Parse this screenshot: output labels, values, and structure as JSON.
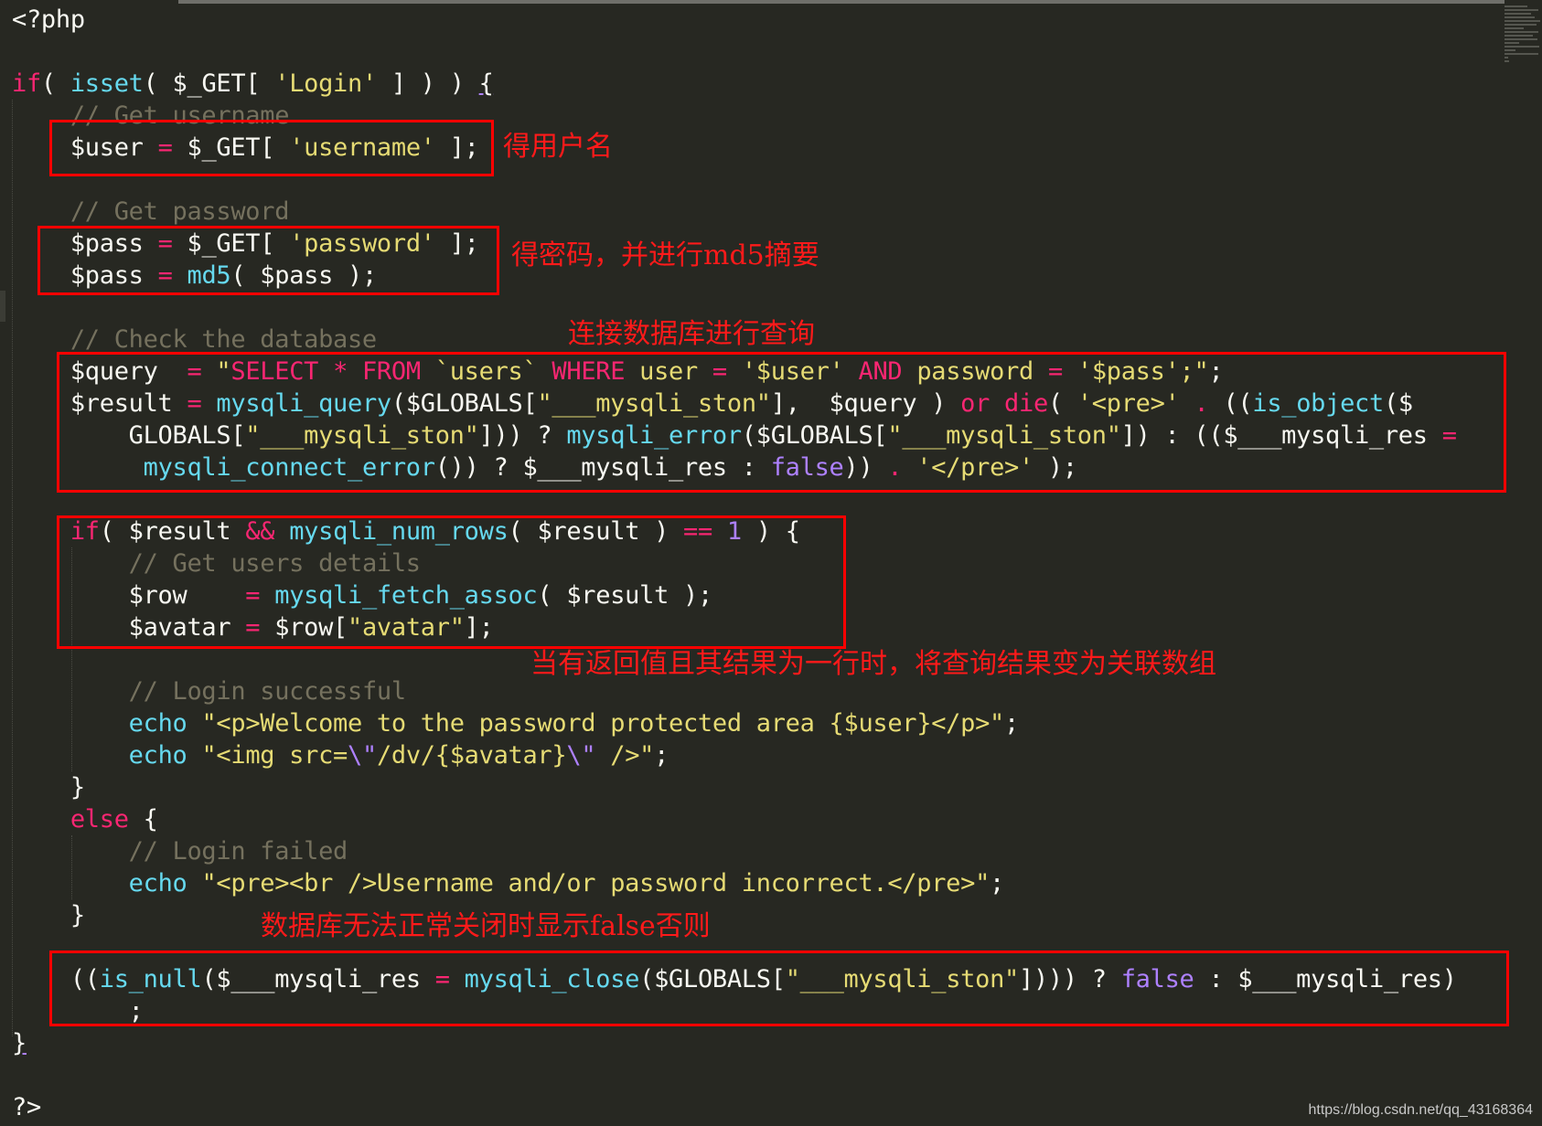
{
  "editor": {
    "theme_colors": {
      "background": "#272822",
      "keyword": "#f92672",
      "function": "#66d9ef",
      "string": "#e6db74",
      "comment": "#75715e",
      "constant": "#ae81ff",
      "annotation": "#ff0000"
    },
    "lines": [
      [
        [
          "",
          "<?php"
        ]
      ],
      [],
      [
        [
          "kw",
          "if"
        ],
        [
          "",
          "( "
        ],
        [
          "fn",
          "isset"
        ],
        [
          "",
          "( $_GET[ "
        ],
        [
          "str",
          "'Login'"
        ],
        [
          "",
          " ] ) ) "
        ],
        [
          "ul",
          "{"
        ]
      ],
      [
        [
          "",
          "    "
        ],
        [
          "cm",
          "// Get username"
        ]
      ],
      [
        [
          "",
          "    $user "
        ],
        [
          "kw",
          "="
        ],
        [
          "",
          " $_GET[ "
        ],
        [
          "str",
          "'username'"
        ],
        [
          "",
          " ];"
        ]
      ],
      [],
      [
        [
          "",
          "    "
        ],
        [
          "cm",
          "// Get password"
        ]
      ],
      [
        [
          "",
          "    $pass "
        ],
        [
          "kw",
          "="
        ],
        [
          "",
          " $_GET[ "
        ],
        [
          "str",
          "'password'"
        ],
        [
          "",
          " ];"
        ]
      ],
      [
        [
          "",
          "    $pass "
        ],
        [
          "kw",
          "="
        ],
        [
          "",
          " "
        ],
        [
          "fn",
          "md5"
        ],
        [
          "",
          "( $pass );"
        ]
      ],
      [],
      [
        [
          "",
          "    "
        ],
        [
          "cm",
          "// Check the database"
        ]
      ],
      [
        [
          "",
          "    $query  "
        ],
        [
          "kw",
          "="
        ],
        [
          "",
          " "
        ],
        [
          "str",
          "\""
        ],
        [
          "kw",
          "SELECT * FROM"
        ],
        [
          "str",
          " `users` "
        ],
        [
          "kw",
          "WHERE"
        ],
        [
          "str",
          " user "
        ],
        [
          "kw",
          "="
        ],
        [
          "str",
          " '$user' "
        ],
        [
          "kw",
          "AND"
        ],
        [
          "str",
          " password "
        ],
        [
          "kw",
          "="
        ],
        [
          "str",
          " '$pass';\""
        ],
        [
          "",
          ";"
        ]
      ],
      [
        [
          "",
          "    $result "
        ],
        [
          "kw",
          "="
        ],
        [
          "",
          " "
        ],
        [
          "fn",
          "mysqli_query"
        ],
        [
          "",
          "($GLOBALS["
        ],
        [
          "str",
          "\"___mysqli_ston\""
        ],
        [
          "",
          "],  $query ) "
        ],
        [
          "kw",
          "or"
        ],
        [
          "",
          " "
        ],
        [
          "kw",
          "die"
        ],
        [
          "",
          "( "
        ],
        [
          "str",
          "'<pre>'"
        ],
        [
          "",
          " "
        ],
        [
          "kw",
          "."
        ],
        [
          "",
          " (("
        ],
        [
          "fn",
          "is_object"
        ],
        [
          "",
          "($"
        ]
      ],
      [
        [
          "",
          "        GLOBALS["
        ],
        [
          "str",
          "\"___mysqli_ston\""
        ],
        [
          "",
          "])) ? "
        ],
        [
          "fn",
          "mysqli_error"
        ],
        [
          "",
          "($GLOBALS["
        ],
        [
          "str",
          "\"___mysqli_ston\""
        ],
        [
          "",
          "]) : (($___mysqli_res "
        ],
        [
          "kw",
          "="
        ]
      ],
      [
        [
          "",
          "         "
        ],
        [
          "fn",
          "mysqli_connect_error"
        ],
        [
          "",
          "()) ? $___mysqli_res : "
        ],
        [
          "cn",
          "false"
        ],
        [
          "",
          "))"
        ],
        [
          "kw",
          " ."
        ],
        [
          "",
          " "
        ],
        [
          "str",
          "'</pre>'"
        ],
        [
          "",
          " );"
        ]
      ],
      [],
      [
        [
          "",
          "    "
        ],
        [
          "kw",
          "if"
        ],
        [
          "",
          "( $result "
        ],
        [
          "kw",
          "&&"
        ],
        [
          "",
          " "
        ],
        [
          "fn",
          "mysqli_num_rows"
        ],
        [
          "",
          "( $result ) "
        ],
        [
          "kw",
          "=="
        ],
        [
          "",
          " "
        ],
        [
          "num",
          "1"
        ],
        [
          "",
          " ) {"
        ]
      ],
      [
        [
          "",
          "        "
        ],
        [
          "cm",
          "// Get users details"
        ]
      ],
      [
        [
          "",
          "        $row    "
        ],
        [
          "kw",
          "="
        ],
        [
          "",
          " "
        ],
        [
          "fn",
          "mysqli_fetch_assoc"
        ],
        [
          "",
          "( $result );"
        ]
      ],
      [
        [
          "",
          "        $avatar "
        ],
        [
          "kw",
          "="
        ],
        [
          "",
          " $row["
        ],
        [
          "str",
          "\"avatar\""
        ],
        [
          "",
          "];"
        ]
      ],
      [],
      [
        [
          "",
          "        "
        ],
        [
          "cm",
          "// Login successful"
        ]
      ],
      [
        [
          "",
          "        "
        ],
        [
          "fn",
          "echo"
        ],
        [
          "",
          " "
        ],
        [
          "str",
          "\"<p>Welcome to the password protected area {$user}</p>\""
        ],
        [
          "",
          ";"
        ]
      ],
      [
        [
          "",
          "        "
        ],
        [
          "fn",
          "echo"
        ],
        [
          "",
          " "
        ],
        [
          "str",
          "\"<img src="
        ],
        [
          "cn",
          "\\\""
        ],
        [
          "str",
          "/dv/{$avatar}"
        ],
        [
          "cn",
          "\\\""
        ],
        [
          "str",
          " />\""
        ],
        [
          "",
          ";"
        ]
      ],
      [
        [
          "",
          "    }"
        ]
      ],
      [
        [
          "",
          "    "
        ],
        [
          "kw",
          "else"
        ],
        [
          "",
          " {"
        ]
      ],
      [
        [
          "",
          "        "
        ],
        [
          "cm",
          "// Login failed"
        ]
      ],
      [
        [
          "",
          "        "
        ],
        [
          "fn",
          "echo"
        ],
        [
          "",
          " "
        ],
        [
          "str",
          "\"<pre><br />Username and/or password incorrect.</pre>\""
        ],
        [
          "",
          ";"
        ]
      ],
      [
        [
          "",
          "    }"
        ]
      ],
      [],
      [
        [
          "",
          "    (("
        ],
        [
          "fn",
          "is_null"
        ],
        [
          "",
          "($___mysqli_res "
        ],
        [
          "kw",
          "="
        ],
        [
          "",
          " "
        ],
        [
          "fn",
          "mysqli_close"
        ],
        [
          "",
          "($GLOBALS["
        ],
        [
          "str",
          "\"___mysqli_ston\""
        ],
        [
          "",
          "]))) ? "
        ],
        [
          "cn",
          "false"
        ],
        [
          "",
          " : $___mysqli_res)"
        ]
      ],
      [
        [
          "",
          "        ;"
        ]
      ],
      [
        [
          "ul",
          "}"
        ]
      ],
      [],
      [
        [
          "",
          "?>"
        ]
      ]
    ]
  },
  "annotations": {
    "get_username": "得用户名",
    "get_password": "得密码，并进行md5摘要",
    "query_db": "连接数据库进行查询",
    "fetch_row": "当有返回值且其结果为一行时，将查询结果变为关联数组",
    "close_db": "数据库无法正常关闭时显示false否则"
  },
  "watermark": "https://blog.csdn.net/qq_43168364"
}
